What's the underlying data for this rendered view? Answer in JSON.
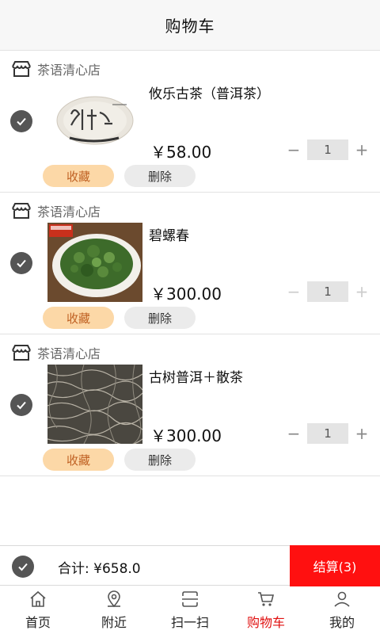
{
  "header": {
    "title": "购物车"
  },
  "cart_items": [
    {
      "store": "茶语清心店",
      "name": "攸乐古茶（普洱茶）",
      "price": "￥58.00",
      "quantity": "1",
      "fav_label": "收藏",
      "delete_label": "删除",
      "checked": true,
      "image": "tea-cake"
    },
    {
      "store": "茶语清心店",
      "name": "碧螺春",
      "price": "￥300.00",
      "quantity": "1",
      "fav_label": "收藏",
      "delete_label": "删除",
      "checked": true,
      "image": "green-tea-bowl"
    },
    {
      "store": "茶语清心店",
      "name": "古树普洱＋散茶",
      "price": "￥300.00",
      "quantity": "1",
      "fav_label": "收藏",
      "delete_label": "删除",
      "checked": true,
      "image": "loose-tea"
    }
  ],
  "footer": {
    "total": "合计: ¥658.0",
    "checkout_label": "结算(3)",
    "accent": "#ff1010"
  },
  "tabs": [
    {
      "label": "首页",
      "icon": "home-icon",
      "active": false
    },
    {
      "label": "附近",
      "icon": "location-icon",
      "active": false
    },
    {
      "label": "扫一扫",
      "icon": "scan-icon",
      "active": false
    },
    {
      "label": "购物车",
      "icon": "cart-icon",
      "active": true
    },
    {
      "label": "我的",
      "icon": "user-icon",
      "active": false
    }
  ]
}
